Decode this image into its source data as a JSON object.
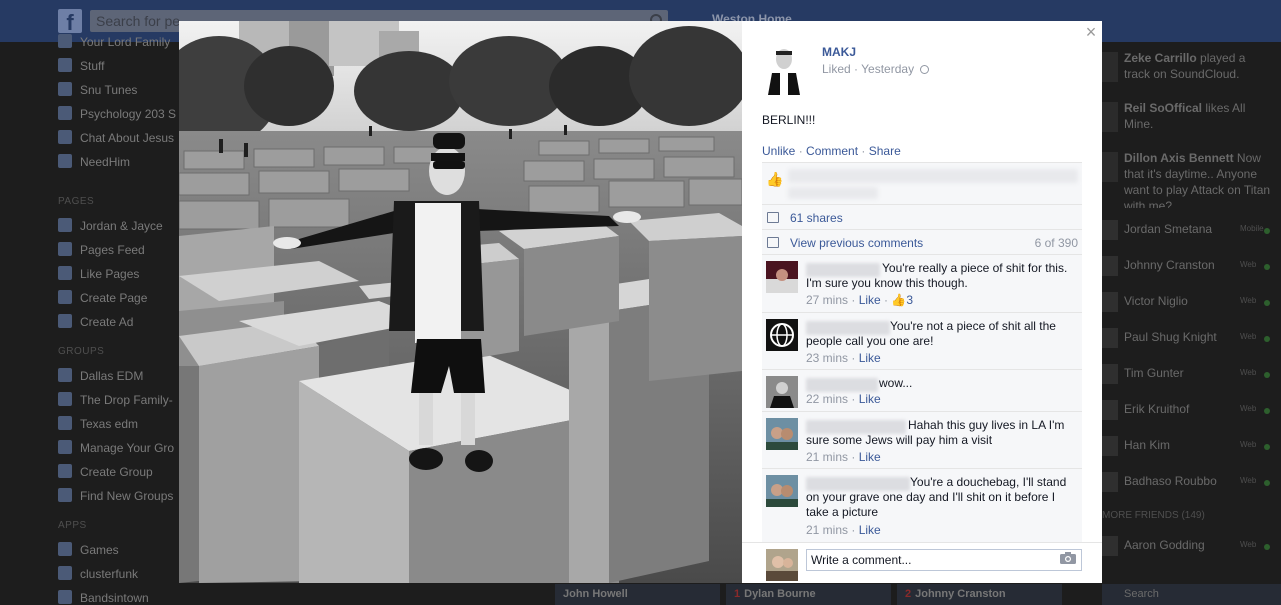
{
  "topbar": {
    "logo": "f",
    "search_placeholder": "Search for pe",
    "nav_text": "Weston   Home"
  },
  "left_nav": {
    "items_top": [
      "Your Lord Family",
      "Stuff",
      "Snu Tunes",
      "Psychology 203 S",
      "Chat About Jesus",
      "NeedHim"
    ],
    "pages_header": "PAGES",
    "pages": [
      "Jordan & Jayce",
      "Pages Feed",
      "Like Pages",
      "Create Page",
      "Create Ad"
    ],
    "groups_header": "GROUPS",
    "groups": [
      "Dallas EDM",
      "The Drop Family-",
      "Texas edm",
      "Manage Your Gro",
      "Create Group",
      "Find New Groups"
    ],
    "apps_header": "APPS",
    "apps": [
      "Games",
      "clusterfunk",
      "Bandsintown"
    ]
  },
  "ticker": [
    {
      "name": "Zeke Carrillo",
      "text": " played a track on SoundCloud."
    },
    {
      "name": "Reil SoOffical",
      "text": " likes All Mine."
    },
    {
      "name": "Dillon Axis Bennett",
      "text": " Now that it's daytime.. Anyone want to play Attack on Titan with me?"
    }
  ],
  "chat": {
    "contacts": [
      {
        "name": "Jordan Smetana",
        "status": "Mobile"
      },
      {
        "name": "Johnny Cranston",
        "status": "Web"
      },
      {
        "name": "Victor Niglio",
        "status": "Web"
      },
      {
        "name": "Paul Shug Knight",
        "status": "Web"
      },
      {
        "name": "Tim Gunter",
        "status": "Web"
      },
      {
        "name": "Erik Kruithof",
        "status": "Web"
      },
      {
        "name": "Han Kim",
        "status": "Web"
      },
      {
        "name": "Badhaso Roubbo",
        "status": "Web"
      }
    ],
    "more_friends": "MORE FRIENDS (149)",
    "more_contacts": [
      {
        "name": "Aaron Godding",
        "status": "Web"
      }
    ],
    "search": "Search"
  },
  "dock": [
    "John Howell",
    "Dylan Bourne",
    "Johnny Cranston"
  ],
  "dock_badges": [
    "1",
    "2"
  ],
  "post": {
    "author": "MAKJ",
    "meta": "Liked · Yesterday",
    "text": "BERLIN!!!",
    "actions": {
      "unlike": "Unlike",
      "comment": "Comment",
      "share": "Share"
    },
    "shares": "61 shares",
    "view_previous": "View previous comments",
    "comment_count": "6 of 390"
  },
  "comments": [
    {
      "text": "You're really a piece of shit for this. I'm sure you know this though.",
      "time": "27 mins",
      "like": "Like",
      "likes": "3"
    },
    {
      "text": "You're not a piece of shit all the people call you one are!",
      "time": "23 mins",
      "like": "Like"
    },
    {
      "text": "wow...",
      "time": "22 mins",
      "like": "Like"
    },
    {
      "text": "Hahah this guy lives in LA I'm sure some Jews will pay him a visit",
      "time": "21 mins",
      "like": "Like"
    },
    {
      "text": "You're a douchebag, I'll stand on your grave one day and I'll shit on it before I take a picture",
      "time": "21 mins",
      "like": "Like"
    }
  ],
  "write_comment_placeholder": "Write a comment...",
  "close_glyph": "×"
}
